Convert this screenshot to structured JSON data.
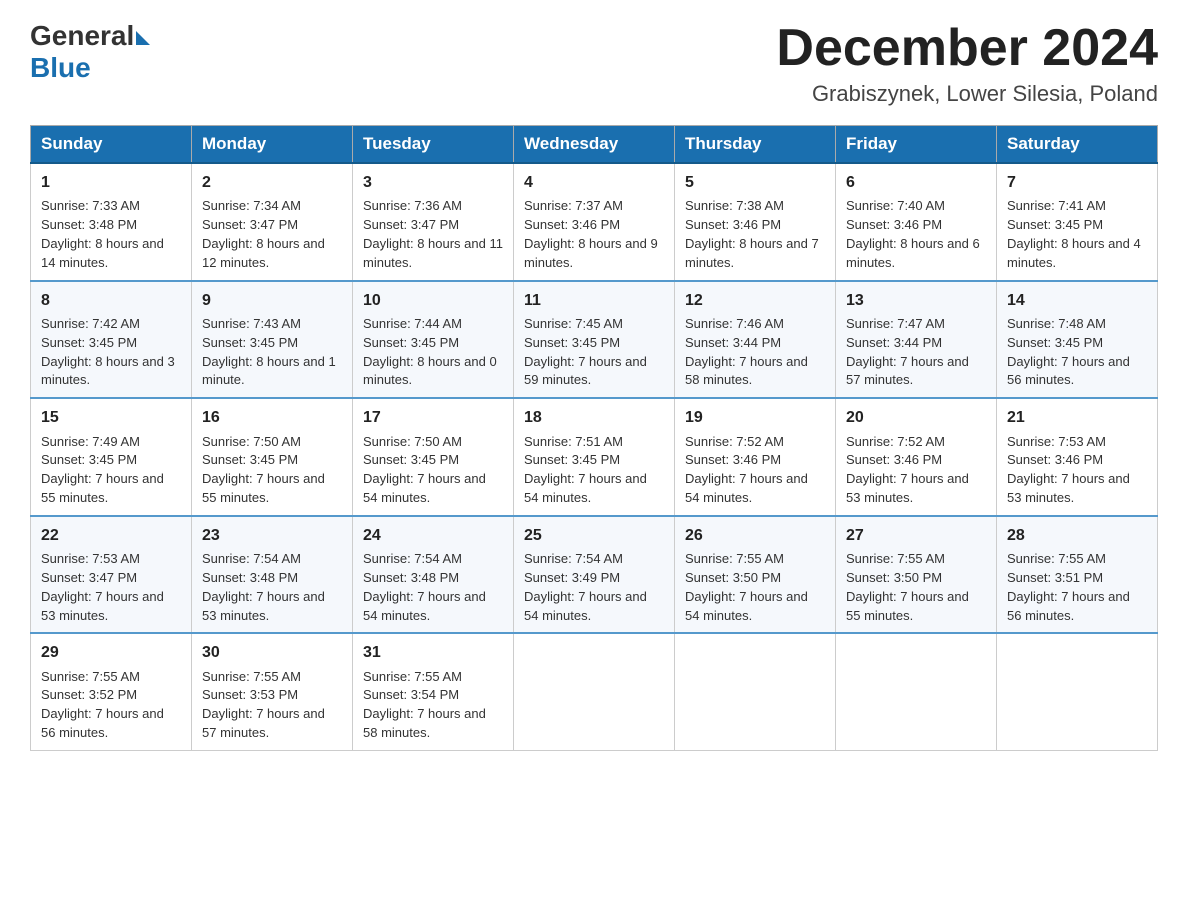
{
  "header": {
    "logo_general": "General",
    "logo_blue": "Blue",
    "month_title": "December 2024",
    "location": "Grabiszynek, Lower Silesia, Poland"
  },
  "days_of_week": [
    "Sunday",
    "Monday",
    "Tuesday",
    "Wednesday",
    "Thursday",
    "Friday",
    "Saturday"
  ],
  "weeks": [
    [
      {
        "day": 1,
        "sunrise": "7:33 AM",
        "sunset": "3:48 PM",
        "daylight": "8 hours and 14 minutes."
      },
      {
        "day": 2,
        "sunrise": "7:34 AM",
        "sunset": "3:47 PM",
        "daylight": "8 hours and 12 minutes."
      },
      {
        "day": 3,
        "sunrise": "7:36 AM",
        "sunset": "3:47 PM",
        "daylight": "8 hours and 11 minutes."
      },
      {
        "day": 4,
        "sunrise": "7:37 AM",
        "sunset": "3:46 PM",
        "daylight": "8 hours and 9 minutes."
      },
      {
        "day": 5,
        "sunrise": "7:38 AM",
        "sunset": "3:46 PM",
        "daylight": "8 hours and 7 minutes."
      },
      {
        "day": 6,
        "sunrise": "7:40 AM",
        "sunset": "3:46 PM",
        "daylight": "8 hours and 6 minutes."
      },
      {
        "day": 7,
        "sunrise": "7:41 AM",
        "sunset": "3:45 PM",
        "daylight": "8 hours and 4 minutes."
      }
    ],
    [
      {
        "day": 8,
        "sunrise": "7:42 AM",
        "sunset": "3:45 PM",
        "daylight": "8 hours and 3 minutes."
      },
      {
        "day": 9,
        "sunrise": "7:43 AM",
        "sunset": "3:45 PM",
        "daylight": "8 hours and 1 minute."
      },
      {
        "day": 10,
        "sunrise": "7:44 AM",
        "sunset": "3:45 PM",
        "daylight": "8 hours and 0 minutes."
      },
      {
        "day": 11,
        "sunrise": "7:45 AM",
        "sunset": "3:45 PM",
        "daylight": "7 hours and 59 minutes."
      },
      {
        "day": 12,
        "sunrise": "7:46 AM",
        "sunset": "3:44 PM",
        "daylight": "7 hours and 58 minutes."
      },
      {
        "day": 13,
        "sunrise": "7:47 AM",
        "sunset": "3:44 PM",
        "daylight": "7 hours and 57 minutes."
      },
      {
        "day": 14,
        "sunrise": "7:48 AM",
        "sunset": "3:45 PM",
        "daylight": "7 hours and 56 minutes."
      }
    ],
    [
      {
        "day": 15,
        "sunrise": "7:49 AM",
        "sunset": "3:45 PM",
        "daylight": "7 hours and 55 minutes."
      },
      {
        "day": 16,
        "sunrise": "7:50 AM",
        "sunset": "3:45 PM",
        "daylight": "7 hours and 55 minutes."
      },
      {
        "day": 17,
        "sunrise": "7:50 AM",
        "sunset": "3:45 PM",
        "daylight": "7 hours and 54 minutes."
      },
      {
        "day": 18,
        "sunrise": "7:51 AM",
        "sunset": "3:45 PM",
        "daylight": "7 hours and 54 minutes."
      },
      {
        "day": 19,
        "sunrise": "7:52 AM",
        "sunset": "3:46 PM",
        "daylight": "7 hours and 54 minutes."
      },
      {
        "day": 20,
        "sunrise": "7:52 AM",
        "sunset": "3:46 PM",
        "daylight": "7 hours and 53 minutes."
      },
      {
        "day": 21,
        "sunrise": "7:53 AM",
        "sunset": "3:46 PM",
        "daylight": "7 hours and 53 minutes."
      }
    ],
    [
      {
        "day": 22,
        "sunrise": "7:53 AM",
        "sunset": "3:47 PM",
        "daylight": "7 hours and 53 minutes."
      },
      {
        "day": 23,
        "sunrise": "7:54 AM",
        "sunset": "3:48 PM",
        "daylight": "7 hours and 53 minutes."
      },
      {
        "day": 24,
        "sunrise": "7:54 AM",
        "sunset": "3:48 PM",
        "daylight": "7 hours and 54 minutes."
      },
      {
        "day": 25,
        "sunrise": "7:54 AM",
        "sunset": "3:49 PM",
        "daylight": "7 hours and 54 minutes."
      },
      {
        "day": 26,
        "sunrise": "7:55 AM",
        "sunset": "3:50 PM",
        "daylight": "7 hours and 54 minutes."
      },
      {
        "day": 27,
        "sunrise": "7:55 AM",
        "sunset": "3:50 PM",
        "daylight": "7 hours and 55 minutes."
      },
      {
        "day": 28,
        "sunrise": "7:55 AM",
        "sunset": "3:51 PM",
        "daylight": "7 hours and 56 minutes."
      }
    ],
    [
      {
        "day": 29,
        "sunrise": "7:55 AM",
        "sunset": "3:52 PM",
        "daylight": "7 hours and 56 minutes."
      },
      {
        "day": 30,
        "sunrise": "7:55 AM",
        "sunset": "3:53 PM",
        "daylight": "7 hours and 57 minutes."
      },
      {
        "day": 31,
        "sunrise": "7:55 AM",
        "sunset": "3:54 PM",
        "daylight": "7 hours and 58 minutes."
      },
      null,
      null,
      null,
      null
    ]
  ]
}
